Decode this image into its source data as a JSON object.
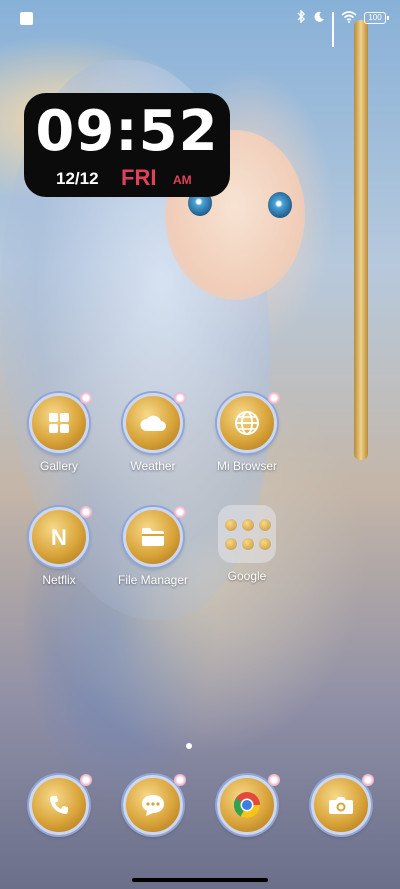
{
  "status_bar": {
    "battery_level": "100"
  },
  "clock_widget": {
    "time": "09:52",
    "date": "12/12",
    "weekday": "FRI",
    "ampm": "AM"
  },
  "home_apps": [
    {
      "label": "Gallery",
      "icon": "gallery-icon"
    },
    {
      "label": "Weather",
      "icon": "weather-icon"
    },
    {
      "label": "Mi Browser",
      "icon": "globe-icon"
    },
    {
      "label": "Netflix",
      "icon": "netflix-icon"
    },
    {
      "label": "File Manager",
      "icon": "folder-icon"
    },
    {
      "label": "Google",
      "icon": "app-folder-icon"
    }
  ],
  "dock": [
    {
      "icon": "phone-icon"
    },
    {
      "icon": "messages-icon"
    },
    {
      "icon": "chrome-icon"
    },
    {
      "icon": "camera-icon"
    }
  ],
  "page_indicator": {
    "pages": 1,
    "current": 1
  }
}
